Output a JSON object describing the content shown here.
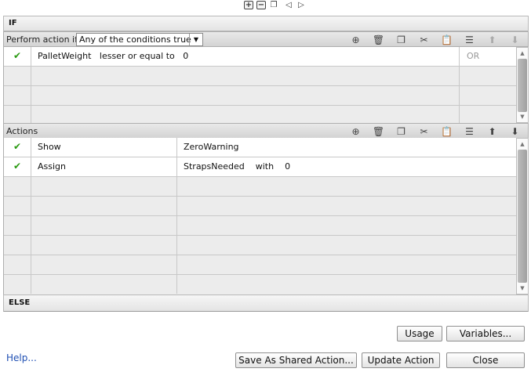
{
  "top_icons": [
    "add-icon",
    "remove-icon",
    "copy-icon",
    "prev-arrow-icon",
    "next-arrow-icon"
  ],
  "if_section": {
    "title": "IF",
    "perform_label": "Perform action if:",
    "condition_mode": "Any of the conditions true",
    "toolbar_icons": [
      "insert-row-icon",
      "delete-icon",
      "copy-icon",
      "cut-icon",
      "paste-icon",
      "insert-after-icon",
      "move-up-icon",
      "move-down-icon"
    ],
    "conditions": [
      {
        "enabled": true,
        "text": "PalletWeight   lesser or equal to   0",
        "connector": "OR"
      }
    ],
    "empty_rows": 3
  },
  "actions_section": {
    "title": "Actions",
    "toolbar_icons": [
      "insert-row-icon",
      "delete-icon",
      "copy-icon",
      "cut-icon",
      "paste-icon",
      "insert-after-icon",
      "move-up-icon",
      "move-down-icon"
    ],
    "actions": [
      {
        "enabled": true,
        "name": "Show",
        "detail": "ZeroWarning"
      },
      {
        "enabled": true,
        "name": "Assign",
        "detail": "StrapsNeeded    with    0"
      }
    ],
    "empty_rows": 6
  },
  "else_section": {
    "title": "ELSE"
  },
  "buttons": {
    "usage": "Usage",
    "variables": "Variables...",
    "save_shared": "Save As Shared Action...",
    "update": "Update Action",
    "close": "Close",
    "help": "Help..."
  },
  "colors": {
    "check": "#2a9a12",
    "link": "#1f4fb3"
  }
}
